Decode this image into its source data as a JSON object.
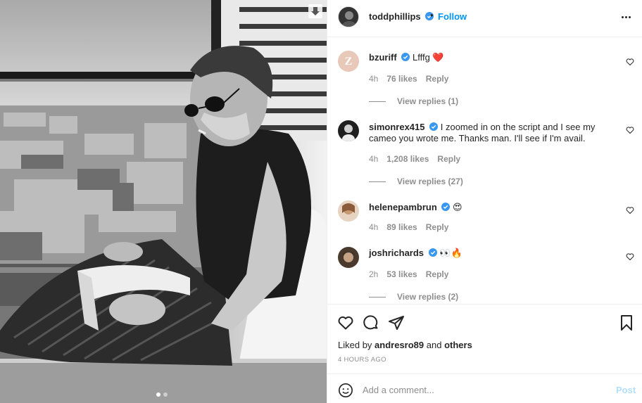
{
  "post": {
    "author": "toddphillips",
    "follow_label": "Follow",
    "separator": "•",
    "more_icon": "more-horizontal-icon"
  },
  "comments": [
    {
      "username": "bzuriff",
      "text": "Lfffg",
      "emoji": "❤️",
      "time": "4h",
      "likes": "76 likes",
      "reply": "Reply",
      "view_replies": "View replies (1)",
      "verified": true
    },
    {
      "username": "simonrex415",
      "text": "I zoomed in on the script and I see my cameo you wrote me. Thanks man. I'll see if I'm avail.",
      "time": "4h",
      "likes": "1,208 likes",
      "reply": "Reply",
      "view_replies": "View replies (27)",
      "verified": true
    },
    {
      "username": "helenepambrun",
      "text": "",
      "emoji": "😍",
      "time": "4h",
      "likes": "89 likes",
      "reply": "Reply",
      "verified": true
    },
    {
      "username": "joshrichards",
      "text": "",
      "emoji": "👀🔥",
      "time": "2h",
      "likes": "53 likes",
      "reply": "Reply",
      "view_replies": "View replies (2)",
      "verified": true
    }
  ],
  "liked_by": {
    "prefix": "Liked by",
    "user": "andresro89",
    "and": "and",
    "others": "others"
  },
  "timestamp": "4 HOURS AGO",
  "add_comment": {
    "placeholder": "Add a comment...",
    "post_label": "Post"
  },
  "colors": {
    "accent": "#0095f6",
    "verified": "#3897f0",
    "muted": "#8e8e8e",
    "heart": "#ed4956"
  },
  "carousel": {
    "total": 2,
    "active": 1
  }
}
